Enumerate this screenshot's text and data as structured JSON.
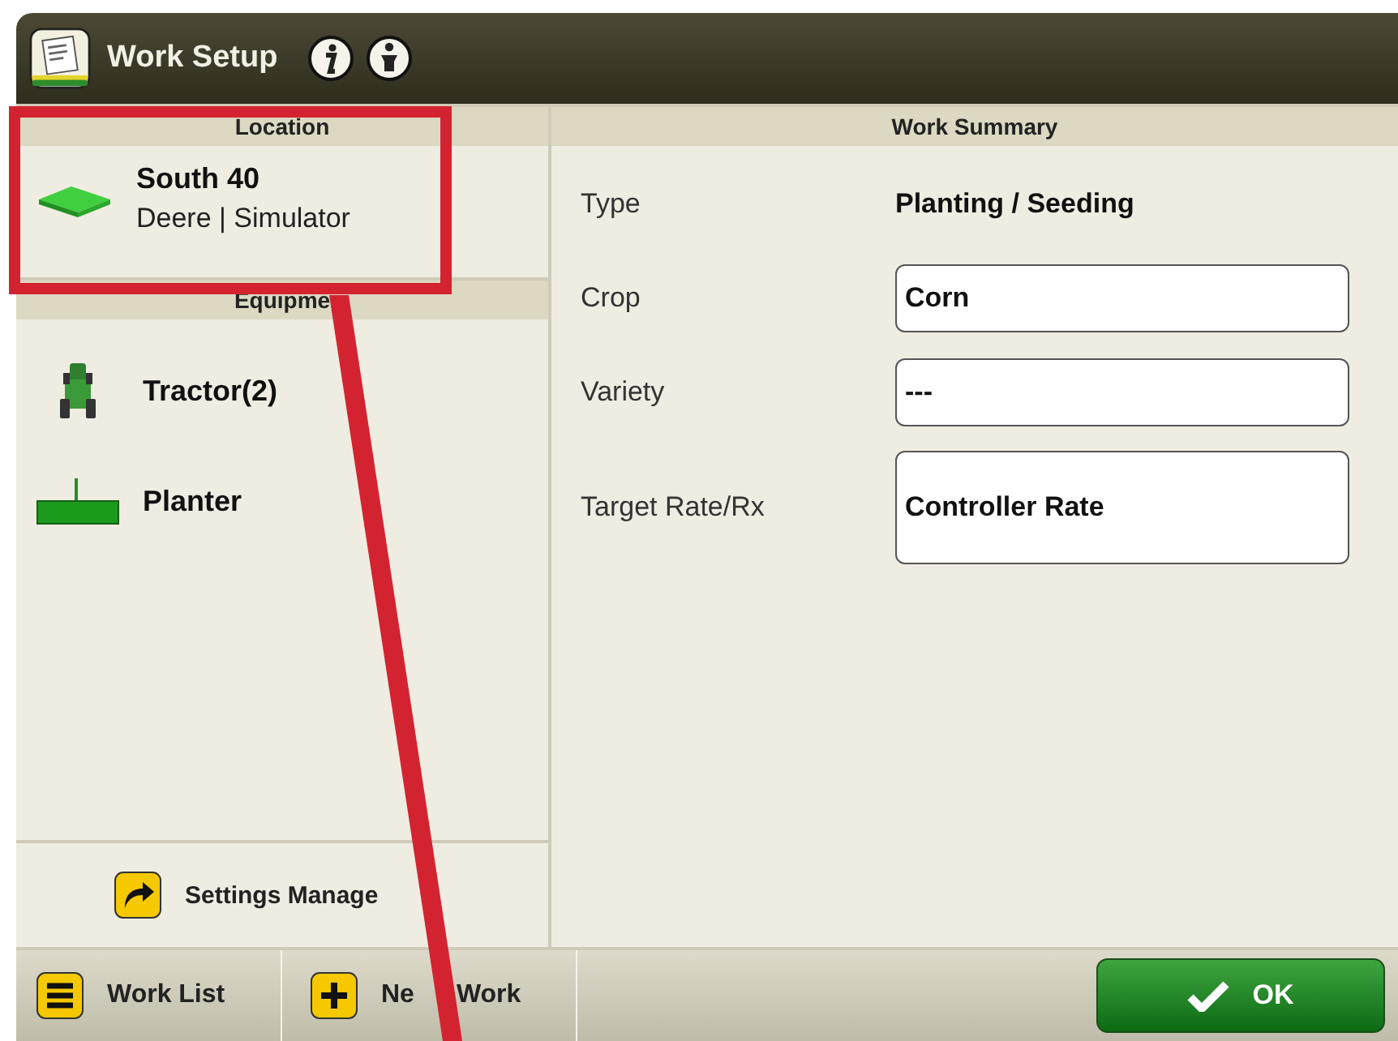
{
  "window": {
    "title": "Work Setup"
  },
  "location": {
    "header": "Location",
    "name": "South 40",
    "detail": "Deere | Simulator"
  },
  "equipment": {
    "header": "Equipme",
    "items": [
      {
        "kind": "tractor",
        "label": "Tractor(2)"
      },
      {
        "kind": "planter",
        "label": "Planter"
      }
    ]
  },
  "settings_button": {
    "label": "Settings Manage"
  },
  "work_summary": {
    "header": "Work Summary",
    "rows": [
      {
        "kind": "text",
        "label": "Type",
        "value": "Planting / Seeding"
      },
      {
        "kind": "field",
        "label": "Crop",
        "value": "Corn"
      },
      {
        "kind": "field",
        "label": "Variety",
        "value": "---"
      },
      {
        "kind": "tallfield",
        "label": "Target Rate/Rx",
        "value": "Controller Rate"
      }
    ]
  },
  "footer": {
    "buttons": [
      {
        "kind": "list",
        "texts": [
          "Work List"
        ]
      },
      {
        "kind": "add",
        "texts": [
          "Ne",
          "Work"
        ]
      }
    ],
    "ok": "OK"
  }
}
